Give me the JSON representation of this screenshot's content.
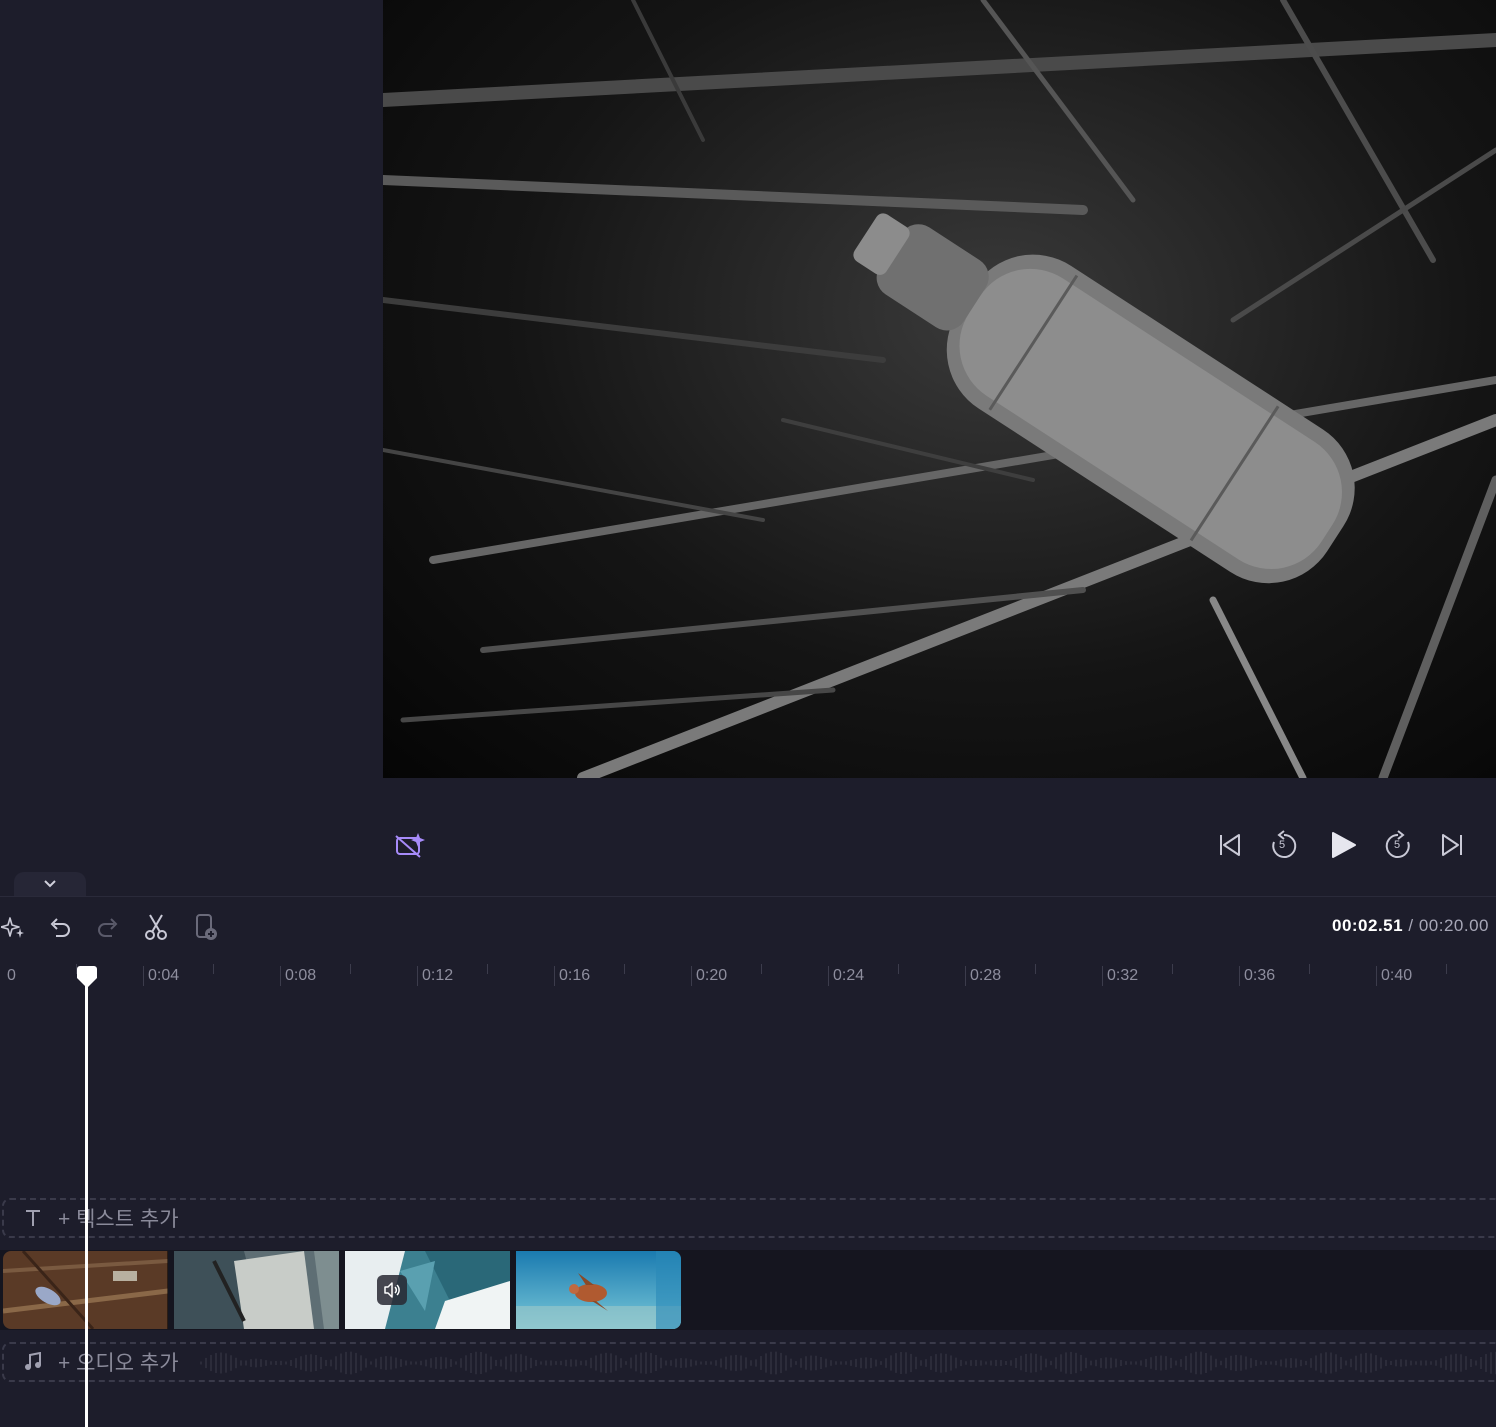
{
  "toolbar": {
    "timecode_current": "00:02.51",
    "timecode_separator": "/",
    "timecode_total": "00:20.00"
  },
  "ruler": {
    "labels": [
      "0",
      "0:04",
      "0:08",
      "0:12",
      "0:16",
      "0:20",
      "0:24",
      "0:28",
      "0:32",
      "0:36",
      "0:40"
    ]
  },
  "tracks": {
    "text_add_label": "+ 텍스트 추가",
    "audio_add_label": "+ 오디오 추가"
  },
  "playback": {
    "rewind_seconds": "5",
    "forward_seconds": "5"
  },
  "colors": {
    "accent": "#8b5cf6",
    "background": "#1d1d2b",
    "playhead": "#ffffff"
  },
  "icons": {
    "magic": "magic-sparkle-icon",
    "undo": "undo-icon",
    "redo": "redo-icon",
    "cut": "scissors-icon",
    "duplicate": "duplicate-icon",
    "skip_back": "skip-back-icon",
    "skip_forward": "skip-forward-icon",
    "play": "play-icon",
    "text": "text-icon",
    "music": "music-note-icon"
  }
}
